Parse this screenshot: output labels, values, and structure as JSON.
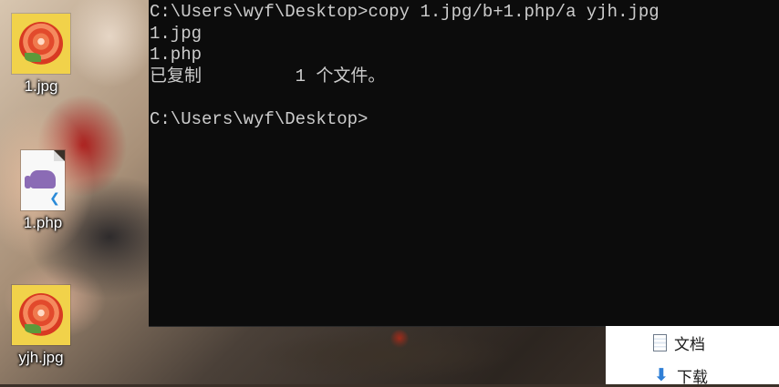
{
  "desktop": {
    "icons": [
      {
        "label": "1.jpg"
      },
      {
        "label": "1.php"
      },
      {
        "label": "yjh.jpg"
      }
    ]
  },
  "console": {
    "lines": [
      "C:\\Users\\wyf\\Desktop>copy 1.jpg/b+1.php/a yjh.jpg",
      "1.jpg",
      "1.php",
      "已复制         1 个文件。",
      "",
      "C:\\Users\\wyf\\Desktop>"
    ],
    "background": "#0c0c0c",
    "text_color": "#cccccc"
  },
  "explorer": {
    "items": [
      {
        "label": "文档",
        "icon": "document-icon"
      },
      {
        "label": "下载",
        "icon": "download-arrow-icon"
      }
    ]
  }
}
